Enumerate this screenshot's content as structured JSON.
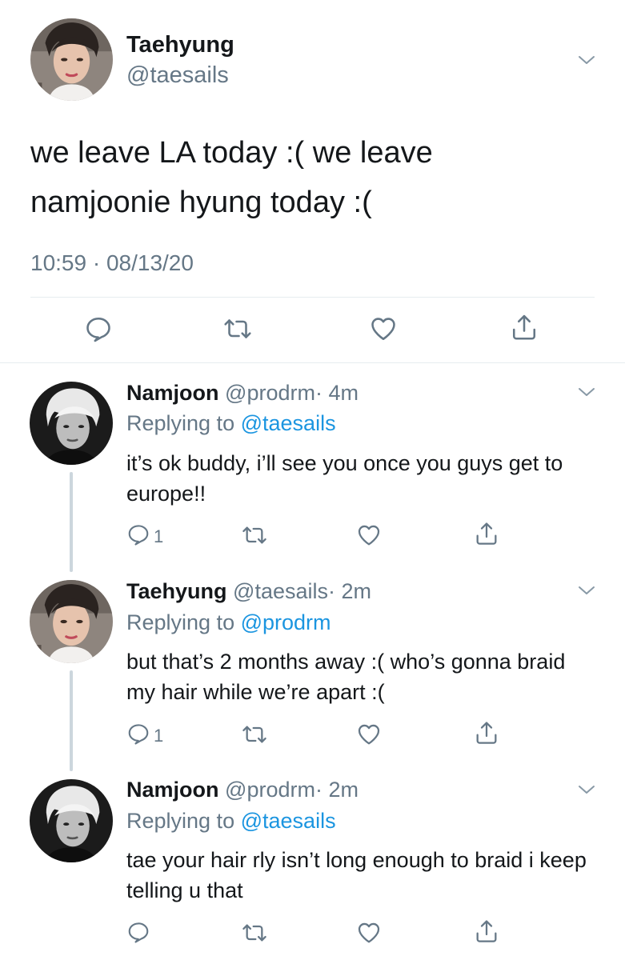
{
  "main_tweet": {
    "name": "Taehyung",
    "handle": "@taesails",
    "text": "we leave LA today :( we leave namjoonie hyung today :(",
    "timestamp": "10:59 · 08/13/20"
  },
  "replies": [
    {
      "name": "Namjoon",
      "handle": "@prodrm",
      "time": "· 4m",
      "replying_prefix": "Replying to",
      "replying_to": "@taesails",
      "text": "it’s ok buddy, i’ll see you once you guys get to europe!!",
      "reply_count": "1"
    },
    {
      "name": "Taehyung",
      "handle": "@taesails",
      "time": "· 2m",
      "replying_prefix": "Replying to",
      "replying_to": "@prodrm",
      "text": "but that’s 2 months away :( who’s gonna braid my hair while we’re apart :(",
      "reply_count": "1"
    },
    {
      "name": "Namjoon",
      "handle": "@prodrm",
      "time": "· 2m",
      "replying_prefix": "Replying to",
      "replying_to": "@taesails",
      "text": "tae your hair rly isn’t long enough to braid i keep telling u that",
      "reply_count": ""
    }
  ],
  "icons": {
    "reply": "reply-icon",
    "retweet": "retweet-icon",
    "like": "heart-icon",
    "share": "share-icon",
    "more": "chevron-down-icon"
  },
  "colors": {
    "text": "#14171a",
    "muted": "#657786",
    "link": "#1b95e0",
    "divider": "#e6ecf0",
    "thread": "#ccd6dd"
  }
}
